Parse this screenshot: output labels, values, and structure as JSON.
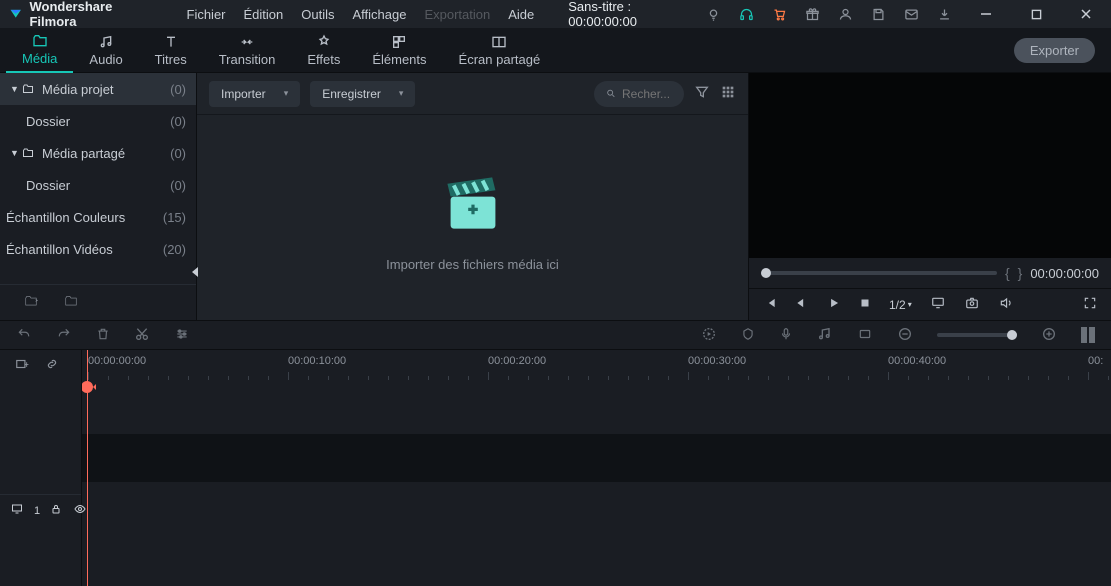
{
  "app": {
    "name": "Wondershare Filmora",
    "title_center": "Sans-titre : 00:00:00:00"
  },
  "menu": {
    "items": [
      "Fichier",
      "Édition",
      "Outils",
      "Affichage",
      "Exportation",
      "Aide"
    ],
    "disabled_idx": 4
  },
  "modetabs": {
    "items": [
      {
        "key": "media",
        "label": "Média"
      },
      {
        "key": "audio",
        "label": "Audio"
      },
      {
        "key": "titres",
        "label": "Titres"
      },
      {
        "key": "transition",
        "label": "Transition"
      },
      {
        "key": "effets",
        "label": "Effets"
      },
      {
        "key": "elements",
        "label": "Éléments"
      },
      {
        "key": "split",
        "label": "Écran partagé"
      }
    ],
    "active": "media",
    "export_label": "Exporter"
  },
  "sidebar": {
    "items": [
      {
        "kind": "group",
        "label": "Média projet",
        "count": "(0)"
      },
      {
        "kind": "child",
        "label": "Dossier",
        "count": "(0)"
      },
      {
        "kind": "group",
        "label": "Média partagé",
        "count": "(0)"
      },
      {
        "kind": "child",
        "label": "Dossier",
        "count": "(0)"
      },
      {
        "kind": "item",
        "label": "Échantillon Couleurs",
        "count": "(15)"
      },
      {
        "kind": "item",
        "label": "Échantillon Vidéos",
        "count": "(20)"
      }
    ]
  },
  "media_toolbar": {
    "import_label": "Importer",
    "record_label": "Enregistrer",
    "search_placeholder": "Recher..."
  },
  "media_browser": {
    "empty_text": "Importer des fichiers média ici"
  },
  "preview": {
    "timecode": "00:00:00:00",
    "ratio": "1/2",
    "markers": {
      "in": "{",
      "out": "}"
    }
  },
  "timeline": {
    "ruler": [
      "00:00:00:00",
      "00:00:10:00",
      "00:00:20:00",
      "00:00:30:00",
      "00:00:40:00",
      "00:"
    ],
    "track1_label": "1"
  }
}
